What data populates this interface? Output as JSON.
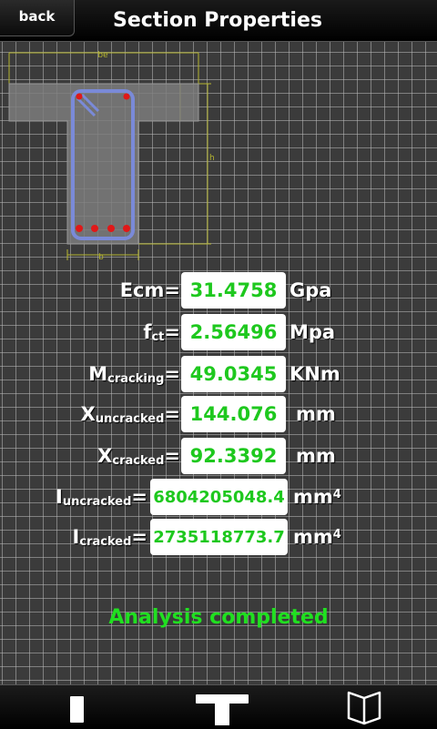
{
  "header": {
    "back_label": "back",
    "title": "Section Properties"
  },
  "drawing": {
    "label_be": "be",
    "label_b": "b",
    "label_h": "h"
  },
  "properties": [
    {
      "name": "Ecm",
      "sub": "",
      "value": "31.4758",
      "unit": "Gpa",
      "unit_sup": ""
    },
    {
      "name": "f",
      "sub": "ct",
      "value": "2.56496",
      "unit": "Mpa",
      "unit_sup": ""
    },
    {
      "name": "M",
      "sub": "cracking",
      "value": "49.0345",
      "unit": "KNm",
      "unit_sup": ""
    },
    {
      "name": "X",
      "sub": "uncracked",
      "value": "144.076",
      "unit": "mm",
      "unit_sup": ""
    },
    {
      "name": "X",
      "sub": "cracked",
      "value": "92.3392",
      "unit": "mm",
      "unit_sup": ""
    },
    {
      "name": "I",
      "sub": "uncracked",
      "value": "6804205048.4",
      "unit": "mm",
      "unit_sup": "4"
    },
    {
      "name": "I",
      "sub": "cracked",
      "value": "2735118773.7",
      "unit": "mm",
      "unit_sup": "4"
    }
  ],
  "status": "Analysis completed",
  "tabs": [
    {
      "icon": "rectangle-section-icon"
    },
    {
      "icon": "t-section-icon"
    },
    {
      "icon": "book-icon"
    }
  ],
  "colors": {
    "value_text": "#1ec81e",
    "status_text": "#20e020",
    "rebar": "#e01818",
    "stirrup": "#7a8ad8"
  }
}
